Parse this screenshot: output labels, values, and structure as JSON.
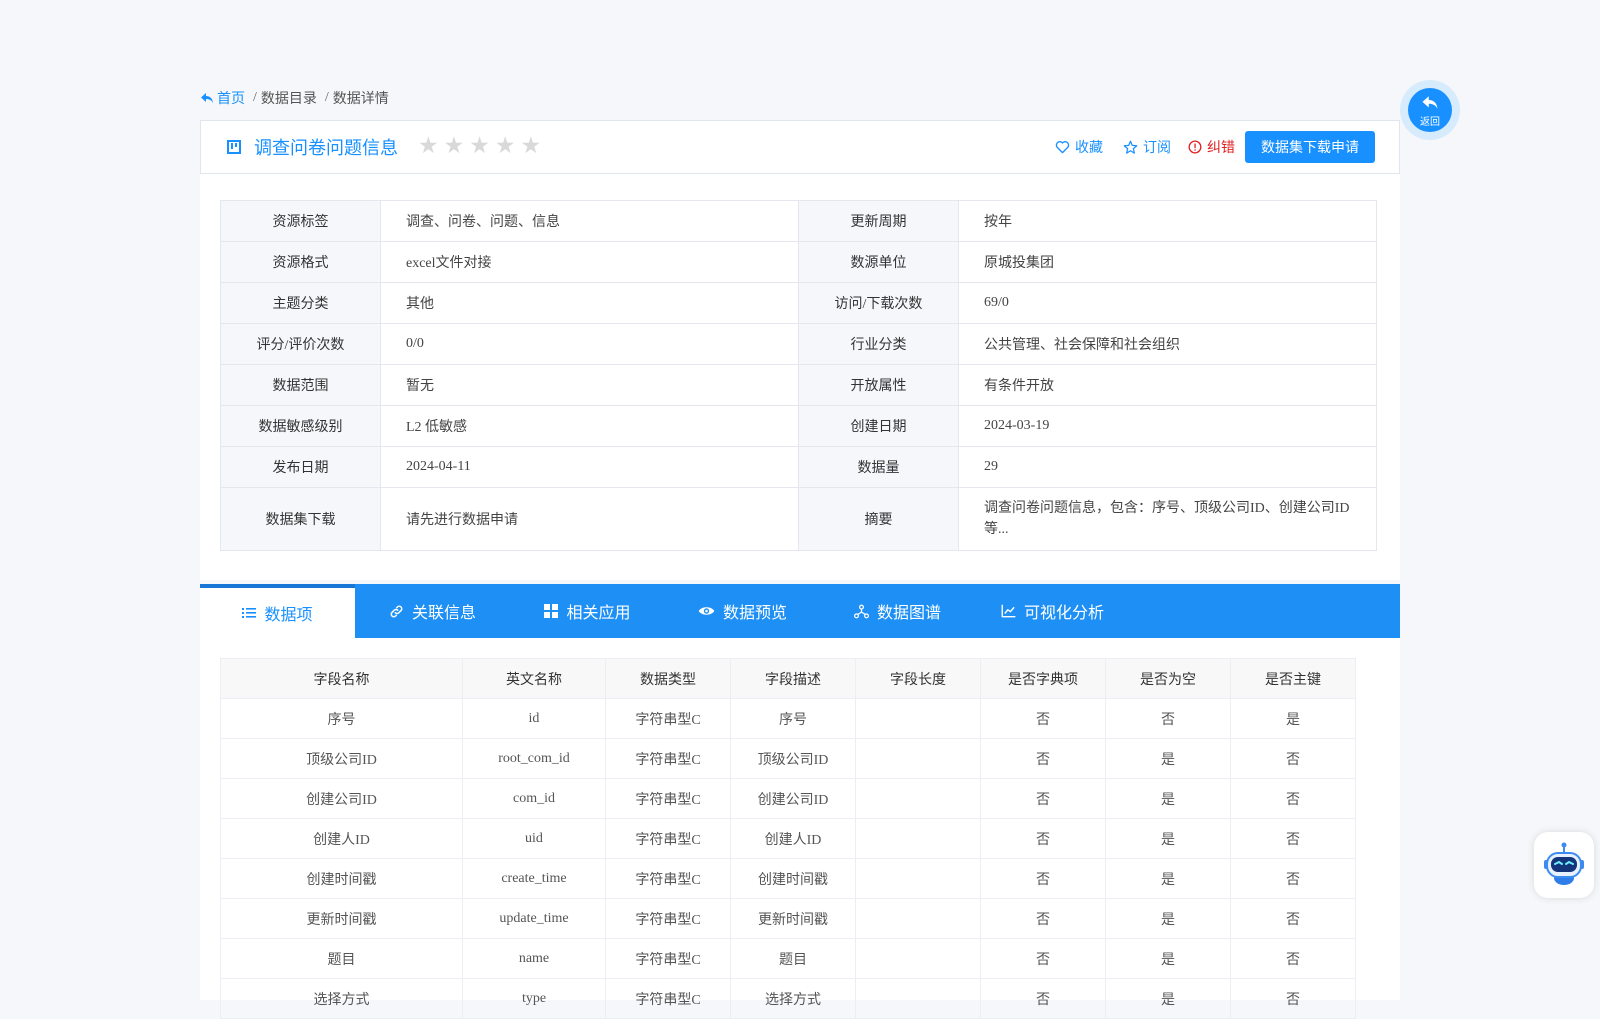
{
  "breadcrumb": {
    "home": "首页",
    "items": [
      "数据目录",
      "数据详情"
    ]
  },
  "header": {
    "title": "调查问卷问题信息",
    "rating_stars": 0,
    "rating_max": 5,
    "favorite_label": "收藏",
    "subscribe_label": "订阅",
    "report_label": "纠错",
    "apply_label": "数据集下载申请"
  },
  "info_rows": [
    [
      "资源标签",
      "调查、问卷、问题、信息",
      "更新周期",
      "按年"
    ],
    [
      "资源格式",
      "excel文件对接",
      "数源单位",
      "原城投集团"
    ],
    [
      "主题分类",
      "其他",
      "访问/下载次数",
      "69/0"
    ],
    [
      "评分/评价次数",
      "0/0",
      "行业分类",
      "公共管理、社会保障和社会组织"
    ],
    [
      "数据范围",
      "暂无",
      "开放属性",
      "有条件开放"
    ],
    [
      "数据敏感级别",
      "L2 低敏感",
      "创建日期",
      "2024-03-19"
    ],
    [
      "发布日期",
      "2024-04-11",
      "数据量",
      "29"
    ],
    [
      "数据集下载",
      "请先进行数据申请",
      "摘要",
      "调查问卷问题信息，包含：序号、顶级公司ID、创建公司ID等..."
    ]
  ],
  "tabs": [
    {
      "label": "数据项",
      "icon": "list-icon"
    },
    {
      "label": "关联信息",
      "icon": "link-icon"
    },
    {
      "label": "相关应用",
      "icon": "grid-icon"
    },
    {
      "label": "数据预览",
      "icon": "eye-icon"
    },
    {
      "label": "数据图谱",
      "icon": "graph-icon"
    },
    {
      "label": "可视化分析",
      "icon": "line-chart-icon"
    }
  ],
  "fields_table": {
    "headers": [
      "字段名称",
      "英文名称",
      "数据类型",
      "字段描述",
      "字段长度",
      "是否字典项",
      "是否为空",
      "是否主键"
    ],
    "rows": [
      [
        "序号",
        "id",
        "字符串型C",
        "序号",
        "",
        "否",
        "否",
        "是"
      ],
      [
        "顶级公司ID",
        "root_com_id",
        "字符串型C",
        "顶级公司ID",
        "",
        "否",
        "是",
        "否"
      ],
      [
        "创建公司ID",
        "com_id",
        "字符串型C",
        "创建公司ID",
        "",
        "否",
        "是",
        "否"
      ],
      [
        "创建人ID",
        "uid",
        "字符串型C",
        "创建人ID",
        "",
        "否",
        "是",
        "否"
      ],
      [
        "创建时间戳",
        "create_time",
        "字符串型C",
        "创建时间戳",
        "",
        "否",
        "是",
        "否"
      ],
      [
        "更新时间戳",
        "update_time",
        "字符串型C",
        "更新时间戳",
        "",
        "否",
        "是",
        "否"
      ],
      [
        "题目",
        "name",
        "字符串型C",
        "题目",
        "",
        "否",
        "是",
        "否"
      ],
      [
        "选择方式",
        "type",
        "字符串型C",
        "选择方式",
        "",
        "否",
        "是",
        "否"
      ]
    ]
  },
  "back_button": {
    "label": "返回"
  },
  "colors": {
    "primary": "#1890ff",
    "tab_bar": "#1e90f5",
    "warn": "#e02020"
  }
}
